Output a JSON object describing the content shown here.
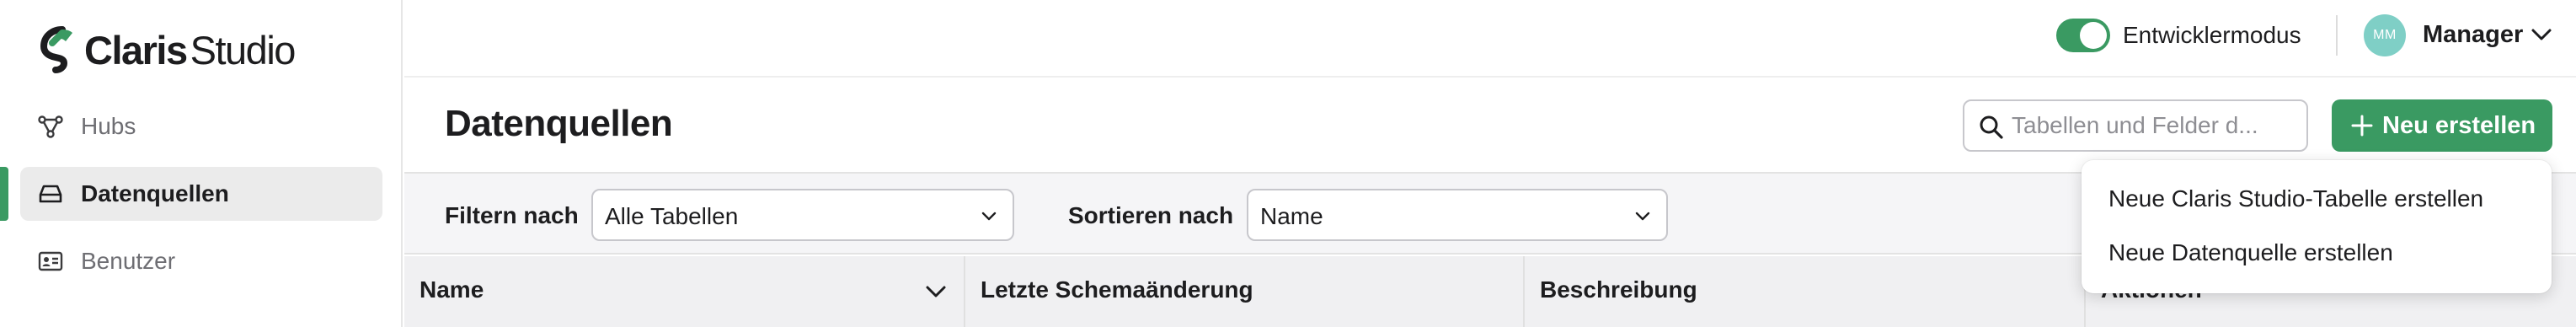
{
  "app": {
    "logo_bold": "Claris",
    "logo_regular": "Studio",
    "brand_color": "#3a9a62"
  },
  "sidebar": {
    "items": [
      {
        "label": "Hubs",
        "icon": "hubs-icon",
        "active": false
      },
      {
        "label": "Datenquellen",
        "icon": "database-icon",
        "active": true
      },
      {
        "label": "Benutzer",
        "icon": "user-card-icon",
        "active": false
      }
    ]
  },
  "topbar": {
    "dev_mode_label": "Entwicklermodus",
    "dev_mode_on": true,
    "avatar_initials": "MM",
    "user_name": "Manager"
  },
  "page": {
    "title": "Datenquellen",
    "search_placeholder": "Tabellen und Felder d...",
    "new_button_label": "Neu erstellen"
  },
  "filters": {
    "filter_label": "Filtern nach",
    "filter_value": "Alle Tabellen",
    "sort_label": "Sortieren nach",
    "sort_value": "Name"
  },
  "table": {
    "columns": [
      "Name",
      "Letzte Schemaänderung",
      "Beschreibung",
      "Aktionen"
    ]
  },
  "new_menu": {
    "items": [
      "Neue Claris Studio-Tabelle erstellen",
      "Neue Datenquelle erstellen"
    ]
  }
}
